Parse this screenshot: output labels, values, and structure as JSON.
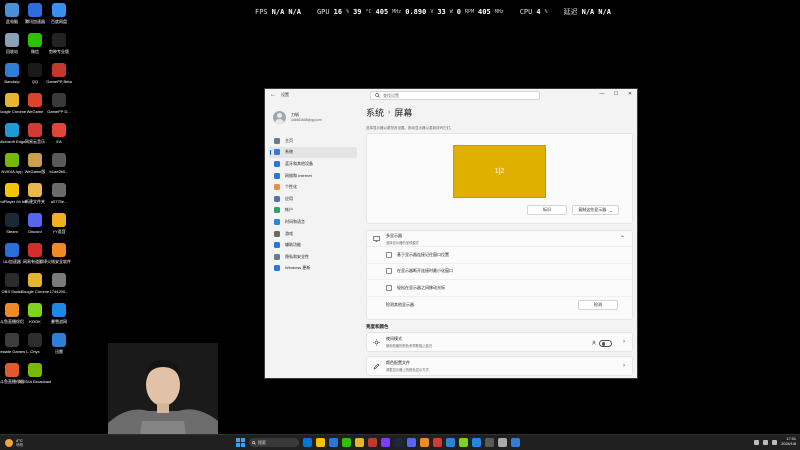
{
  "overlay": {
    "fps_label": "FPS",
    "fps_value": "N/A",
    "fps_value2": "N/A",
    "gpu_label": "GPU",
    "gpu_usage": "16",
    "gpu_usage_unit": "%",
    "gpu_temp": "39",
    "gpu_temp_unit": "°C",
    "gpu_clock": "405",
    "gpu_clock_unit": "MHz",
    "gpu_voltage": "0.890",
    "gpu_voltage_unit": "V",
    "gpu_power": "33",
    "gpu_power_unit": "W",
    "gpu_fan": "0",
    "gpu_fan_unit": "RPM",
    "gpu_mem_clock": "405",
    "gpu_mem_clock_unit": "MHz",
    "cpu_label": "CPU",
    "cpu_usage": "4",
    "cpu_usage_unit": "%",
    "latency_label": "延迟",
    "latency_value": "N/A",
    "latency_value2": "N/A"
  },
  "desktop_icons": [
    {
      "label": "此电脑",
      "color": "#4a90d9"
    },
    {
      "label": "腾讯加速器",
      "color": "#2b6de0"
    },
    {
      "label": "百度网盘",
      "color": "#3a8ef0"
    },
    {
      "label": "回收站",
      "color": "#8aa0b5"
    },
    {
      "label": "微信",
      "color": "#2dc100"
    },
    {
      "label": "剪映专业版",
      "color": "#222222"
    },
    {
      "label": "Bandizip",
      "color": "#2f7fd6"
    },
    {
      "label": "QQ",
      "color": "#1a1a1a"
    },
    {
      "label": "GamePP Beta",
      "color": "#c0392b"
    },
    {
      "label": "Google Chrome",
      "color": "#e5b530"
    },
    {
      "label": "WeGame",
      "color": "#d9442b"
    },
    {
      "label": "GamePP D...",
      "color": "#3a3a3a"
    },
    {
      "label": "Microsoft Edge",
      "color": "#1f9ad6"
    },
    {
      "label": "网易云音乐",
      "color": "#d33a31"
    },
    {
      "label": "EA",
      "color": "#e0463a"
    },
    {
      "label": "NVIDIA App",
      "color": "#76b900"
    },
    {
      "label": "WeGame版",
      "color": "#c9a14a"
    },
    {
      "label": "b1ae2b0...",
      "color": "#5a5a5a"
    },
    {
      "label": "PotPlayer 64 bit",
      "color": "#f5c400"
    },
    {
      "label": "新建文件夹",
      "color": "#e8b94a"
    },
    {
      "label": "a0775e...",
      "color": "#6a6a6a"
    },
    {
      "label": "Steam",
      "color": "#1b2838"
    },
    {
      "label": "Discord",
      "color": "#5865f2"
    },
    {
      "label": "YY语音",
      "color": "#f0b020"
    },
    {
      "label": "UU加速器",
      "color": "#2a6fd8"
    },
    {
      "label": "网易有道翻译",
      "color": "#d92b2b"
    },
    {
      "label": "火绒安全软件",
      "color": "#f08a24"
    },
    {
      "label": "OBS Studio",
      "color": "#2b2b2b"
    },
    {
      "label": "Google Chrome",
      "color": "#e5b530"
    },
    {
      "label": "1744200...",
      "color": "#7a7a7a"
    },
    {
      "label": "斗鱼直播伴侣",
      "color": "#f08a24"
    },
    {
      "label": "KOOK",
      "color": "#7ed321"
    },
    {
      "label": "暴雪战网",
      "color": "#1e88e5"
    },
    {
      "label": "Battlestate Games L...",
      "color": "#3d3d3d"
    },
    {
      "label": "Onyx",
      "color": "#2d2d2d"
    },
    {
      "label": "迅雷",
      "color": "#2f7fd6"
    },
    {
      "label": "斗鱼直播伴侣",
      "color": "#e05a2b"
    },
    {
      "label": "NVIDIA Broadcast",
      "color": "#76b900"
    }
  ],
  "window": {
    "title": "设置",
    "search_placeholder": "查找设置",
    "user": {
      "name": "刀斩",
      "email": "444661608@qq.com"
    },
    "nav": [
      {
        "label": "主页",
        "color": "#6b7b8c"
      },
      {
        "label": "系统",
        "color": "#3a79c9"
      },
      {
        "label": "蓝牙和其他设备",
        "color": "#2b77d6"
      },
      {
        "label": "网络和 Internet",
        "color": "#2b77d6"
      },
      {
        "label": "个性化",
        "color": "#e0924a"
      },
      {
        "label": "应用",
        "color": "#5b6fb5"
      },
      {
        "label": "帐户",
        "color": "#2ba36a"
      },
      {
        "label": "时间和语言",
        "color": "#2b87d6"
      },
      {
        "label": "游戏",
        "color": "#6a6a6a"
      },
      {
        "label": "辅助功能",
        "color": "#2b77d6"
      },
      {
        "label": "隐私和安全性",
        "color": "#6b7b8c"
      },
      {
        "label": "Windows 更新",
        "color": "#2b77d6"
      }
    ],
    "breadcrumb_parent": "系统",
    "breadcrumb_sep": "›",
    "breadcrumb_current": "屏幕",
    "description": "选择显示器以更改其设置。拖动显示器以重新排列它们。",
    "monitor_label": "1|2",
    "identify_button": "标识",
    "duplicate_button": "复制这些显示器",
    "multi": {
      "title": "多显示器",
      "subtitle": "选择显示器的呈现模式",
      "options": [
        "基于显示器连接记住窗口位置",
        "在显示器断开连接时最小化窗口",
        "轻松在显示器之间移动光标"
      ],
      "detect_label": "检测其他显示器",
      "detect_button": "检测"
    },
    "section_label": "亮度和颜色",
    "night_light": {
      "title": "夜间模式",
      "subtitle": "使用较暖的颜色来帮助阻止蓝光",
      "state": "关"
    },
    "color_profile": {
      "title": "颜色配置文件",
      "subtitle": "调整显示器上的颜色显示方式"
    }
  },
  "taskbar": {
    "weather_temp": "4°C",
    "weather_cond": "晴朗",
    "search_text": "搜索",
    "time": "17:01",
    "date": "2024/1/8",
    "app_colors": [
      "#0078d4",
      "#f5c400",
      "#2b77d6",
      "#2dc100",
      "#e5b530",
      "#c0392b",
      "#7d3cff",
      "#1b2838",
      "#5865f2",
      "#f08a24",
      "#d33a31",
      "#2b87d6",
      "#7ed321",
      "#1e88e5",
      "#5a5a5a",
      "#aaaaaa",
      "#2f7fd6"
    ]
  }
}
